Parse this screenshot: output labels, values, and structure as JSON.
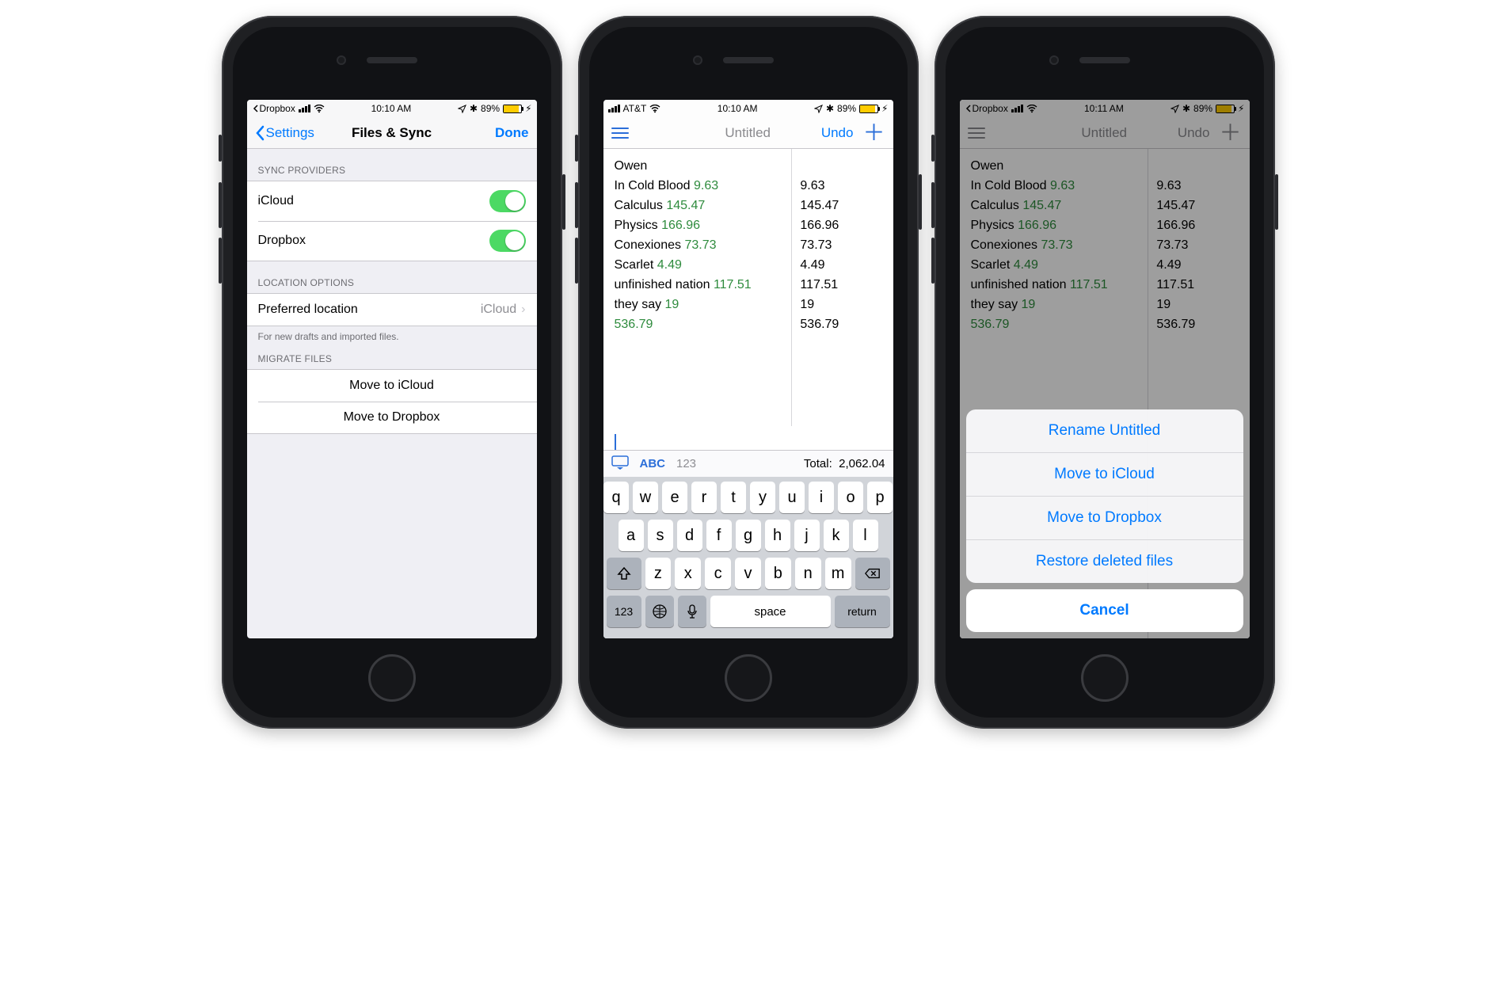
{
  "phone1": {
    "status": {
      "back_app": "Dropbox",
      "time": "10:10 AM",
      "battery": "89%"
    },
    "nav": {
      "back": "Settings",
      "title": "Files & Sync",
      "done": "Done"
    },
    "sync_header": "SYNC PROVIDERS",
    "providers": [
      {
        "label": "iCloud",
        "on": true
      },
      {
        "label": "Dropbox",
        "on": true
      }
    ],
    "loc_header": "LOCATION OPTIONS",
    "pref_loc_label": "Preferred location",
    "pref_loc_value": "iCloud",
    "loc_footer": "For new drafts and imported files.",
    "migrate_header": "MIGRATE FILES",
    "migrate": [
      "Move to iCloud",
      "Move to Dropbox"
    ]
  },
  "phone2": {
    "status": {
      "carrier": "AT&T",
      "time": "10:10 AM",
      "battery": "89%"
    },
    "nav": {
      "title": "Untitled",
      "undo": "Undo"
    },
    "lines": [
      {
        "text": "Owen",
        "num": "",
        "res": ""
      },
      {
        "text": "In Cold Blood",
        "num": "9.63",
        "res": "9.63"
      },
      {
        "text": "Calculus",
        "num": "145.47",
        "res": "145.47"
      },
      {
        "text": "Physics",
        "num": "166.96",
        "res": "166.96"
      },
      {
        "text": "Conexiones",
        "num": "73.73",
        "res": "73.73"
      },
      {
        "text": "Scarlet",
        "num": "4.49",
        "res": "4.49"
      },
      {
        "text": "unfinished nation",
        "num": "117.51",
        "res": "117.51"
      },
      {
        "text": "they say",
        "num": "19",
        "res": "19"
      },
      {
        "text": "",
        "num": "536.79",
        "res": "536.79"
      }
    ],
    "acc": {
      "abc": "ABC",
      "num": "123",
      "total_label": "Total:",
      "total_value": "2,062.04"
    },
    "keys": {
      "row1": [
        "q",
        "w",
        "e",
        "r",
        "t",
        "y",
        "u",
        "i",
        "o",
        "p"
      ],
      "row2": [
        "a",
        "s",
        "d",
        "f",
        "g",
        "h",
        "j",
        "k",
        "l"
      ],
      "row3": [
        "z",
        "x",
        "c",
        "v",
        "b",
        "n",
        "m"
      ],
      "num": "123",
      "space": "space",
      "ret": "return"
    }
  },
  "phone3": {
    "status": {
      "back_app": "Dropbox",
      "time": "10:11 AM",
      "battery": "89%"
    },
    "nav": {
      "title": "Untitled",
      "undo": "Undo"
    },
    "lines_ref": "phone2.lines",
    "sheet": {
      "actions": [
        "Rename Untitled",
        "Move to iCloud",
        "Move to Dropbox",
        "Restore deleted files"
      ],
      "cancel": "Cancel"
    }
  }
}
